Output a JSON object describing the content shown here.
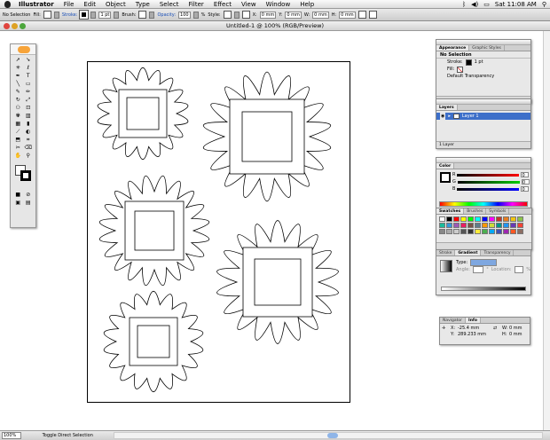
{
  "menubar": {
    "app": "Illustrator",
    "items": [
      "File",
      "Edit",
      "Object",
      "Type",
      "Select",
      "Filter",
      "Effect",
      "View",
      "Window",
      "Help"
    ],
    "clock": "Sat 11:08 AM"
  },
  "control": {
    "selection": "No Selection",
    "fill_label": "Fill:",
    "stroke_label": "Stroke:",
    "stroke_weight": "1 pt",
    "brush_label": "Brush:",
    "opacity_label": "Opacity:",
    "opacity_value": "100",
    "opacity_unit": "%",
    "style_label": "Style:",
    "x_label": "X:",
    "x_value": "0 mm",
    "y_label": "Y:",
    "y_value": "0 mm",
    "w_label": "W:",
    "w_value": "0 mm",
    "h_label": "H:",
    "h_value": "0 mm"
  },
  "document": {
    "title": "Untitled-1 @ 100% (RGB/Preview)"
  },
  "appearance_panel": {
    "tab_active": "Appearance",
    "tab_other": "Graphic Styles",
    "heading": "No Selection",
    "stroke_label": "Stroke:",
    "stroke_value": "1 pt",
    "fill_label": "Fill:",
    "transparency": "Default Transparency"
  },
  "layers_panel": {
    "tab": "Layers",
    "layer_name": "Layer 1",
    "footer": "1 Layer"
  },
  "color_panel": {
    "tab": "Color",
    "r": "R",
    "g": "G",
    "b": "B",
    "r_val": "0",
    "g_val": "0",
    "b_val": "0"
  },
  "swatches_panel": {
    "tabs": [
      "Swatches",
      "Brushes",
      "Symbols"
    ]
  },
  "gradient_panel": {
    "tabs": [
      "Stroke",
      "Gradient",
      "Transparency"
    ],
    "type_label": "Type:",
    "angle_label": "Angle:",
    "location_label": "Location:",
    "angle_unit": "°",
    "location_unit": "%"
  },
  "info_panel": {
    "tabs": [
      "Navigator",
      "Info"
    ],
    "x_label": "X:",
    "x_value": "-25.4 mm",
    "y_label": "Y:",
    "y_value": "289.233 mm",
    "w_label": "W:",
    "w_value": "0 mm",
    "h_label": "H:",
    "h_value": "0 mm"
  },
  "status": {
    "zoom": "100%",
    "tool": "Toggle Direct Selection"
  },
  "colors": {
    "accent": "#1a4fb8",
    "panel_bg": "#e8e8e8"
  }
}
